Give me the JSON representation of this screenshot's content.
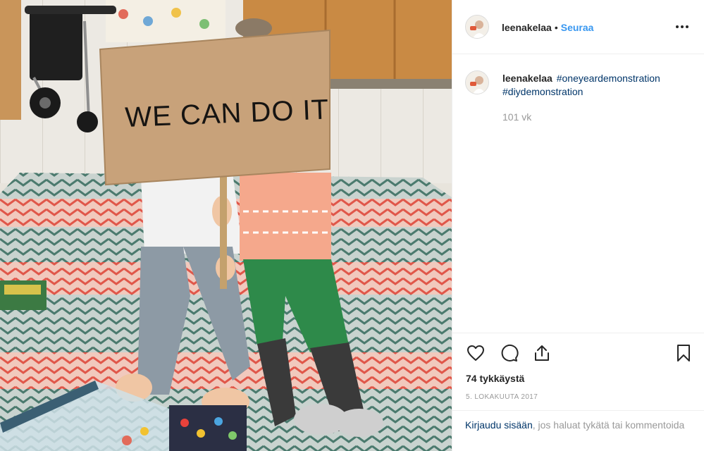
{
  "post": {
    "sign_text": "WE CAN DO IT"
  },
  "header": {
    "username": "leenakelaa",
    "separator": "•",
    "follow_label": "Seuraa"
  },
  "caption": {
    "username": "leenakelaa",
    "hashtags": [
      "#oneyeardemonstration",
      "#diydemonstration"
    ],
    "age": "101 vk"
  },
  "actions": {
    "icons": [
      "heart-icon",
      "comment-icon",
      "share-icon",
      "bookmark-icon"
    ],
    "likes": "74 tykkäystä",
    "date": "5. LOKAKUUTA 2017"
  },
  "login": {
    "link_text": "Kirjaudu sisään",
    "rest_text": ", jos haluat tykätä tai kommentoida"
  },
  "colors": {
    "follow_blue": "#3897f0",
    "link_navy": "#003569",
    "muted_grey": "#999999",
    "divider": "#efefef"
  }
}
